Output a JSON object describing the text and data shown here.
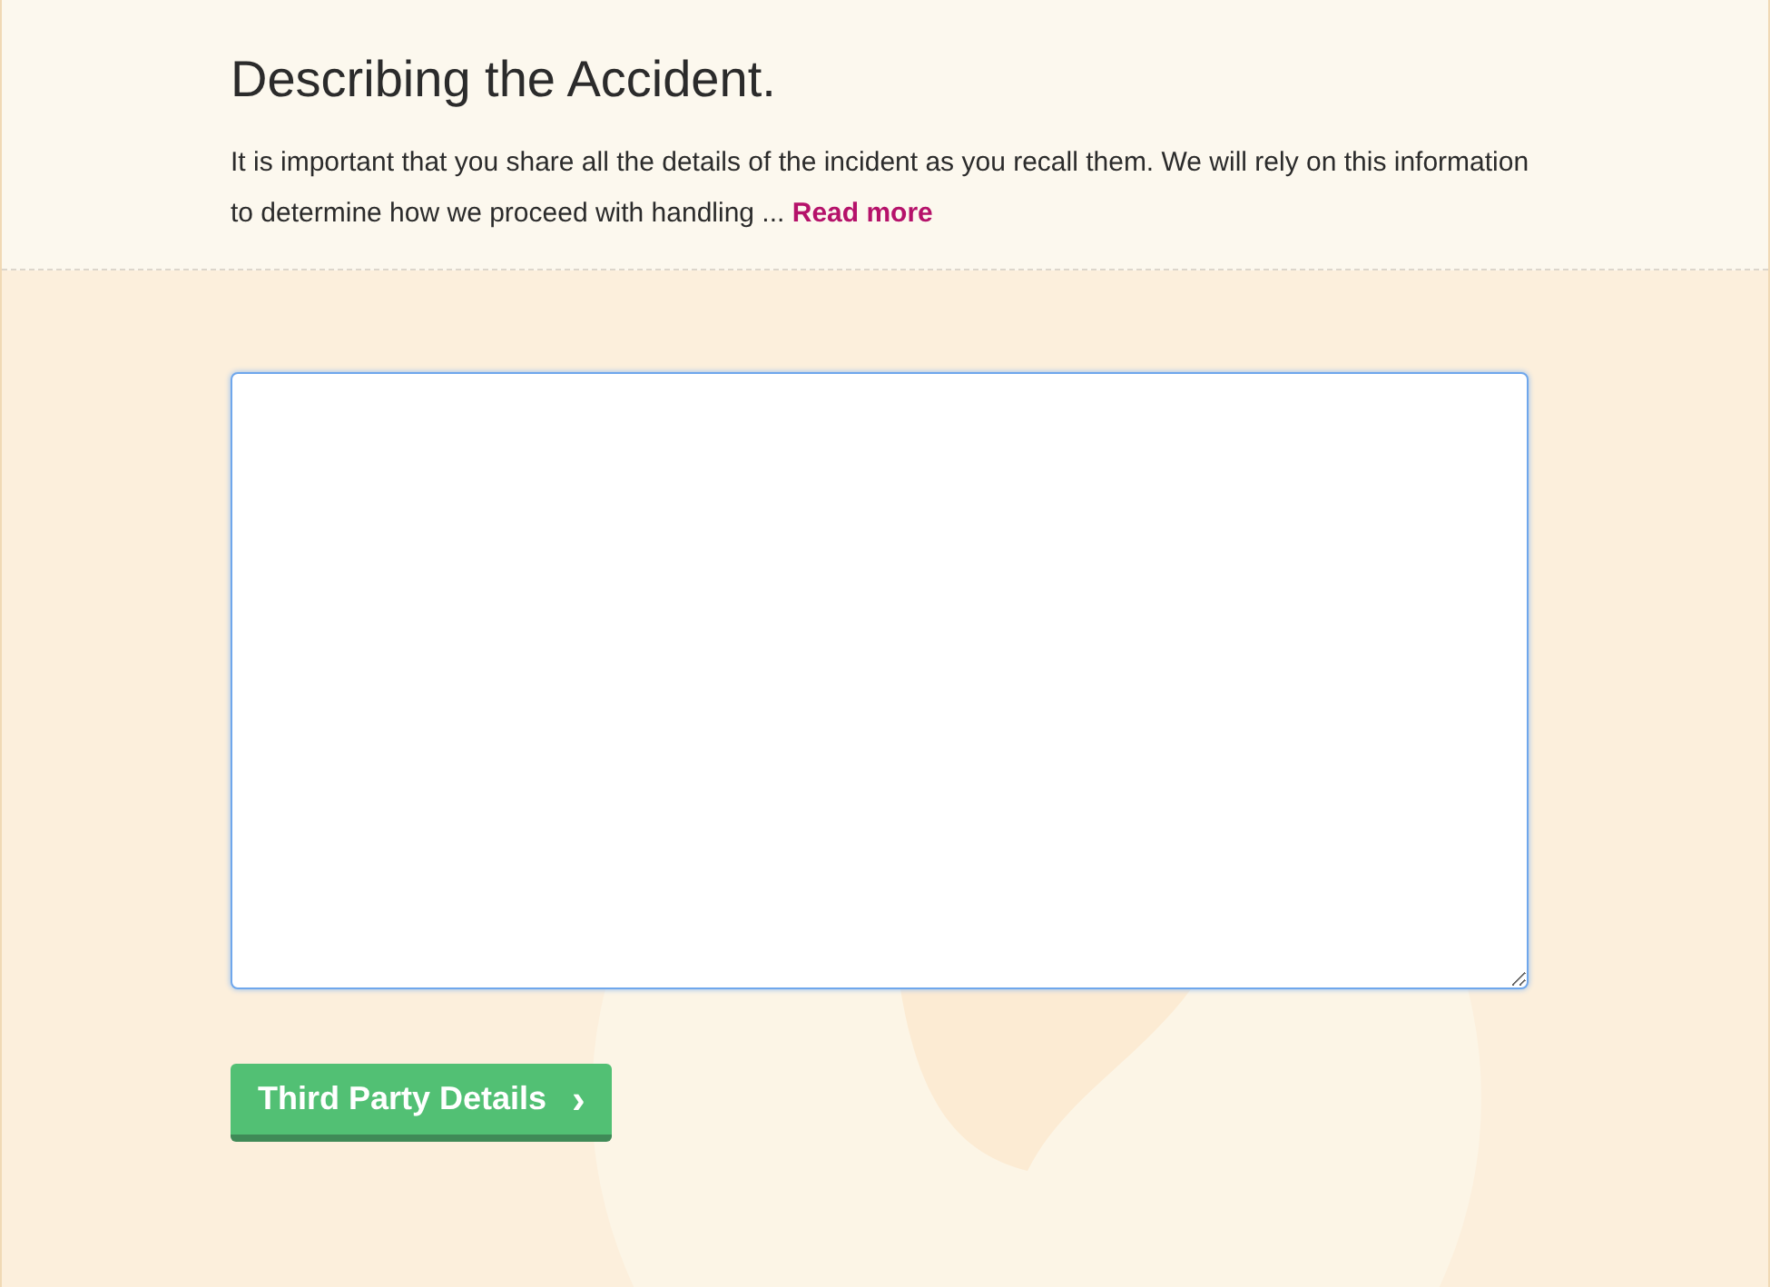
{
  "header": {
    "title": "Describing the Accident.",
    "description": "It is important that you share all the details of the incident as you recall them. We will rely on this information to determine how we proceed with handling ...",
    "link": "Read more"
  },
  "next_button": {
    "label": "Third Party Details",
    "icon": "›"
  }
}
